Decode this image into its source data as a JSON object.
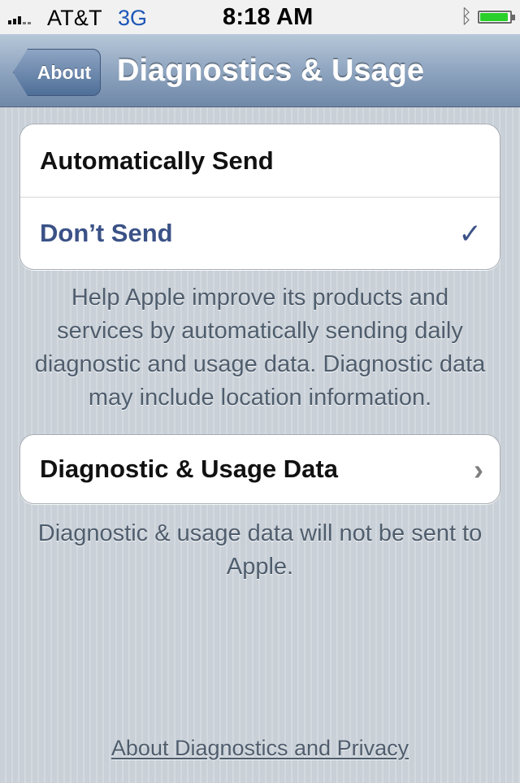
{
  "status_bar": {
    "carrier": "AT&T",
    "network": "3G",
    "time": "8:18 AM",
    "battery_level_percent": 95
  },
  "navigation": {
    "back_label": "About",
    "title": "Diagnostics & Usage"
  },
  "send_options": [
    {
      "label": "Automatically Send",
      "selected": false
    },
    {
      "label": "Don’t Send",
      "selected": true
    }
  ],
  "help_text": "Help Apple improve its products and services by automatically sending daily diagnostic and usage data. Diagnostic data may include location information.",
  "diagnostic_data_row": {
    "label": "Diagnostic & Usage Data"
  },
  "status_message": "Diagnostic & usage data will not be sent to Apple.",
  "privacy_link": "About Diagnostics and Privacy",
  "colors": {
    "selected_text": "#3b5287",
    "network": "#1d56b7",
    "battery": "#2ad02a",
    "background": "#cbd2d8"
  },
  "icons": {
    "signal": "signal-strength-icon",
    "bluetooth": "bluetooth-icon",
    "battery": "battery-icon",
    "checkmark": "checkmark-icon",
    "chevron": "chevron-right-icon"
  }
}
